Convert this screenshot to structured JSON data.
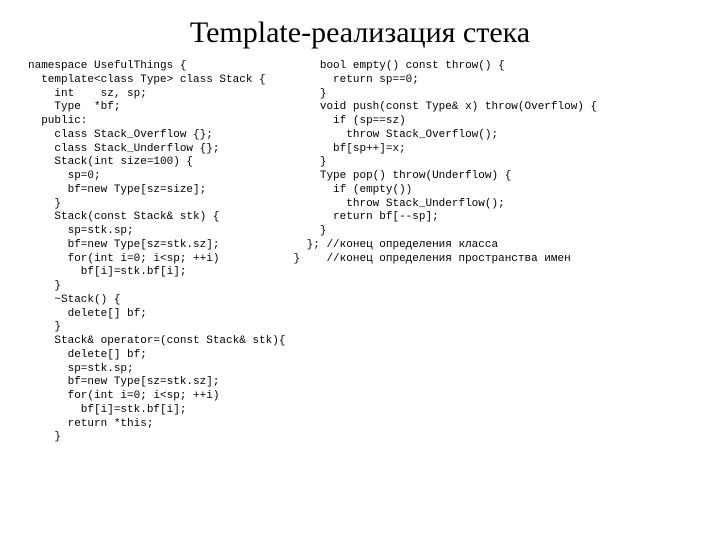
{
  "slide": {
    "title": "Template-реализация стека"
  },
  "code": {
    "left": "namespace UsefulThings {\n  template<class Type> class Stack {\n    int    sz, sp;\n    Type  *bf;\n  public:\n    class Stack_Overflow {};\n    class Stack_Underflow {};\n    Stack(int size=100) {\n      sp=0;\n      bf=new Type[sz=size];\n    }\n    Stack(const Stack& stk) {\n      sp=stk.sp;\n      bf=new Type[sz=stk.sz];\n      for(int i=0; i<sp; ++i)\n        bf[i]=stk.bf[i];\n    }\n    ~Stack() {\n      delete[] bf;\n    }\n    Stack& operator=(const Stack& stk){\n      delete[] bf;\n      sp=stk.sp;\n      bf=new Type[sz=stk.sz];\n      for(int i=0; i<sp; ++i)\n        bf[i]=stk.bf[i];\n      return *this;\n    }",
    "right": "    bool empty() const throw() {\n      return sp==0;\n    }\n    void push(const Type& x) throw(Overflow) {\n      if (sp==sz)\n        throw Stack_Overflow();\n      bf[sp++]=x;\n    }\n    Type pop() throw(Underflow) {\n      if (empty())\n        throw Stack_Underflow();\n      return bf[--sp];\n    }\n  }; //конец определения класса\n}    //конец определения пространства имен"
  }
}
